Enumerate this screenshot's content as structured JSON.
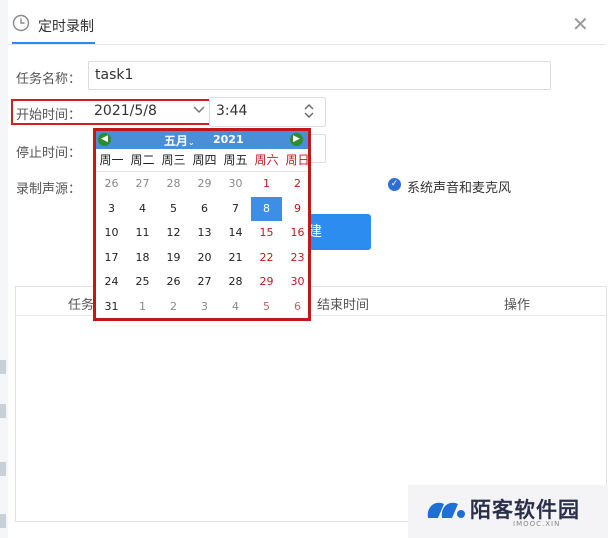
{
  "dialog": {
    "title": "定时录制",
    "close_glyph": "✕"
  },
  "form": {
    "task_name_label": "任务名称：",
    "task_name_value": "task1",
    "start_label": "开始时间：",
    "start_date": "2021/5/8",
    "start_time_partial": "3:44",
    "stop_label": "停止时间：",
    "source_label": "录制声源：",
    "source_option": "系统声音和麦克风",
    "create_button_partial": "建"
  },
  "table": {
    "col_task_partial": "任务",
    "col_end_time": "结束时间",
    "col_action": "操作"
  },
  "calendar": {
    "month_label": "五月",
    "year_label": "2021",
    "weekdays": [
      "周一",
      "周二",
      "周三",
      "周四",
      "周五",
      "周六",
      "周日"
    ],
    "weeks": [
      [
        "26",
        "27",
        "28",
        "29",
        "30",
        "1",
        "2"
      ],
      [
        "3",
        "4",
        "5",
        "6",
        "7",
        "8",
        "9"
      ],
      [
        "10",
        "11",
        "12",
        "13",
        "14",
        "15",
        "16"
      ],
      [
        "17",
        "18",
        "19",
        "20",
        "21",
        "22",
        "23"
      ],
      [
        "24",
        "25",
        "26",
        "27",
        "28",
        "29",
        "30"
      ],
      [
        "31",
        "1",
        "2",
        "3",
        "4",
        "5",
        "6"
      ]
    ],
    "selected_day": "8"
  },
  "watermark": {
    "text": "陌客软件园",
    "sub": "IMOOC.XIN"
  },
  "colors": {
    "accent": "#2d8cf0",
    "highlight_border": "#d11f1f",
    "weekend_red": "#c8141a",
    "calendar_header": "#4b8ed8"
  }
}
